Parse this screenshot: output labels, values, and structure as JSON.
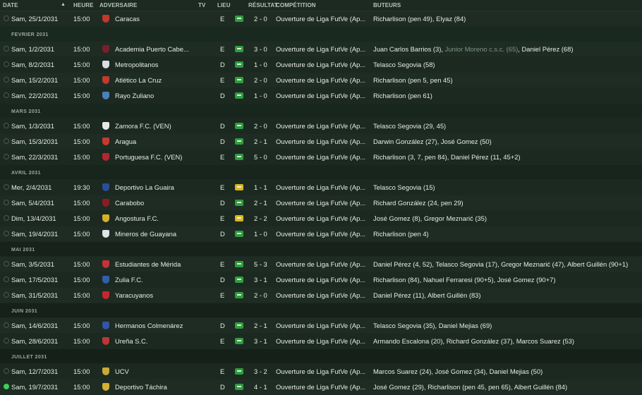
{
  "header": {
    "date": "DATE",
    "time": "HEURE",
    "opponent": "ADVERSAIRE",
    "tv": "TV",
    "venue": "LIEU",
    "result": "RÉSULTAT",
    "competition": "COMPÉTITION",
    "scorers": "BUTEURS"
  },
  "colors": {
    "win": "#2e9e3e",
    "draw": "#d9b820",
    "selected_check": "#3ecf5a"
  },
  "rows": [
    {
      "kind": "match",
      "date": "Sam, 25/1/2031",
      "time": "15:00",
      "opponent": "Caracas",
      "crest": "#c0392b",
      "venue": "E",
      "res": "win",
      "score": "2 - 0",
      "comp": "Ouverture de Liga FutVe (Ap...",
      "scorers": "Richarlison (pen 49), Elyaz (84)"
    },
    {
      "kind": "month",
      "label": "FÉVRIER 2031"
    },
    {
      "kind": "match",
      "date": "Sam, 1/2/2031",
      "time": "15:00",
      "opponent": "Academia Puerto Cabe...",
      "crest": "#7a1f2b",
      "venue": "E",
      "res": "win",
      "score": "3 - 0",
      "comp": "Ouverture de Liga FutVe (Ap...",
      "scorers": "Juan Carlos Barrios (3), ",
      "scorers_sub": "Junior Moreno c.s.c. (65)",
      "scorers_post": ", Daniel Pérez (68)"
    },
    {
      "kind": "match",
      "date": "Sam, 8/2/2031",
      "time": "15:00",
      "opponent": "Metropolitanos",
      "crest": "#d9dde0",
      "venue": "D",
      "res": "win",
      "score": "1 - 0",
      "comp": "Ouverture de Liga FutVe (Ap...",
      "scorers": "Telasco Segovia (58)"
    },
    {
      "kind": "match",
      "date": "Sam, 15/2/2031",
      "time": "15:00",
      "opponent": "Atlético La Cruz",
      "crest": "#c23b2e",
      "venue": "E",
      "res": "win",
      "score": "2 - 0",
      "comp": "Ouverture de Liga FutVe (Ap...",
      "scorers": "Richarlison (pen 5, pen 45)"
    },
    {
      "kind": "match",
      "date": "Sam, 22/2/2031",
      "time": "15:00",
      "opponent": "Rayo Zuliano",
      "crest": "#4d7fb8",
      "venue": "D",
      "res": "win",
      "score": "1 - 0",
      "comp": "Ouverture de Liga FutVe (Ap...",
      "scorers": "Richarlison (pen 61)"
    },
    {
      "kind": "month",
      "label": "MARS 2031"
    },
    {
      "kind": "match",
      "date": "Sam, 1/3/2031",
      "time": "15:00",
      "opponent": "Zamora F.C. (VEN)",
      "crest": "#e8e8e8",
      "venue": "D",
      "res": "win",
      "score": "2 - 0",
      "comp": "Ouverture de Liga FutVe (Ap...",
      "scorers": "Telasco Segovia (29, 45)"
    },
    {
      "kind": "match",
      "date": "Sam, 15/3/2031",
      "time": "15:00",
      "opponent": "Aragua",
      "crest": "#c7392f",
      "venue": "D",
      "res": "win",
      "score": "2 - 1",
      "comp": "Ouverture de Liga FutVe (Ap...",
      "scorers": "Darwin González (27), José Gomez (50)"
    },
    {
      "kind": "match",
      "date": "Sam, 22/3/2031",
      "time": "15:00",
      "opponent": "Portuguesa F.C. (VEN)",
      "crest": "#b4262f",
      "venue": "E",
      "res": "win",
      "score": "5 - 0",
      "comp": "Ouverture de Liga FutVe (Ap...",
      "scorers": "Richarlison (3, 7, pen 84), Daniel Pérez (11, 45+2)"
    },
    {
      "kind": "month",
      "label": "AVRIL 2031"
    },
    {
      "kind": "match",
      "date": "Mer, 2/4/2031",
      "time": "19:30",
      "opponent": "Deportivo La Guaira",
      "crest": "#2a4e9a",
      "venue": "E",
      "res": "draw",
      "score": "1 - 1",
      "comp": "Ouverture de Liga FutVe (Ap...",
      "scorers": "Telasco Segovia (15)"
    },
    {
      "kind": "match",
      "date": "Sam, 5/4/2031",
      "time": "15:00",
      "opponent": "Carabobo",
      "crest": "#8b1c24",
      "venue": "D",
      "res": "win",
      "score": "2 - 1",
      "comp": "Ouverture de Liga FutVe (Ap...",
      "scorers": "Richard González (24, pen 29)"
    },
    {
      "kind": "match",
      "date": "Dim, 13/4/2031",
      "time": "15:00",
      "opponent": "Angostura F.C.",
      "crest": "#d6b02a",
      "venue": "E",
      "res": "draw",
      "score": "2 - 2",
      "comp": "Ouverture de Liga FutVe (Ap...",
      "scorers": "José Gomez (8), Gregor Meznarić (35)"
    },
    {
      "kind": "match",
      "date": "Sam, 19/4/2031",
      "time": "15:00",
      "opponent": "Mineros de Guayana",
      "crest": "#dfe3e6",
      "venue": "D",
      "res": "win",
      "score": "1 - 0",
      "comp": "Ouverture de Liga FutVe (Ap...",
      "scorers": "Richarlison (pen 4)"
    },
    {
      "kind": "month",
      "label": "MAI 2031"
    },
    {
      "kind": "match",
      "date": "Sam, 3/5/2031",
      "time": "15:00",
      "opponent": "Estudiantes de Mérida",
      "crest": "#c9313a",
      "venue": "E",
      "res": "win",
      "score": "5 - 3",
      "comp": "Ouverture de Liga FutVe (Ap...",
      "scorers": "Daniel Pérez (4, 52), Telasco Segovia (17), Gregor Meznarić (47), Albert Guillén (90+1)"
    },
    {
      "kind": "match",
      "date": "Sam, 17/5/2031",
      "time": "15:00",
      "opponent": "Zulia F.C.",
      "crest": "#2f5fa8",
      "venue": "D",
      "res": "win",
      "score": "3 - 1",
      "comp": "Ouverture de Liga FutVe (Ap...",
      "scorers": "Richarlison (84), Nahuel Ferraresi (90+5), José Gomez (90+7)"
    },
    {
      "kind": "match",
      "date": "Sam, 31/5/2031",
      "time": "15:00",
      "opponent": "Yaracuyanos",
      "crest": "#c8262f",
      "venue": "E",
      "res": "win",
      "score": "2 - 0",
      "comp": "Ouverture de Liga FutVe (Ap...",
      "scorers": "Daniel Pérez (11), Albert Guillén (83)"
    },
    {
      "kind": "month",
      "label": "JUIN 2031"
    },
    {
      "kind": "match",
      "date": "Sam, 14/6/2031",
      "time": "15:00",
      "opponent": "Hermanos Colmenárez",
      "crest": "#3454a6",
      "venue": "D",
      "res": "win",
      "score": "2 - 1",
      "comp": "Ouverture de Liga FutVe (Ap...",
      "scorers": "Telasco Segovia (35), Daniel Mejias (69)"
    },
    {
      "kind": "match",
      "date": "Sam, 28/6/2031",
      "time": "15:00",
      "opponent": "Ureña S.C.",
      "crest": "#c03535",
      "venue": "E",
      "res": "win",
      "score": "3 - 1",
      "comp": "Ouverture de Liga FutVe (Ap...",
      "scorers": "Armando Escalona (20), Richard González (37), Marcos Suarez (53)"
    },
    {
      "kind": "month",
      "label": "JUILLET 2031"
    },
    {
      "kind": "match",
      "date": "Sam, 12/7/2031",
      "time": "15:00",
      "opponent": "UCV",
      "crest": "#c9a83a",
      "venue": "E",
      "res": "win",
      "score": "3 - 2",
      "comp": "Ouverture de Liga FutVe (Ap...",
      "scorers": "Marcos Suarez (24), José Gomez (34), Daniel Mejias (50)"
    },
    {
      "kind": "match",
      "date": "Sam, 19/7/2031",
      "time": "15:00",
      "opponent": "Deportivo Táchira",
      "crest": "#d4b12e",
      "venue": "D",
      "res": "win",
      "score": "4 - 1",
      "comp": "Ouverture de Liga FutVe (Ap...",
      "scorers": "José Gomez (29), Richarlison (pen 45, pen 65), Albert Guillén (84)",
      "selected": true
    }
  ]
}
